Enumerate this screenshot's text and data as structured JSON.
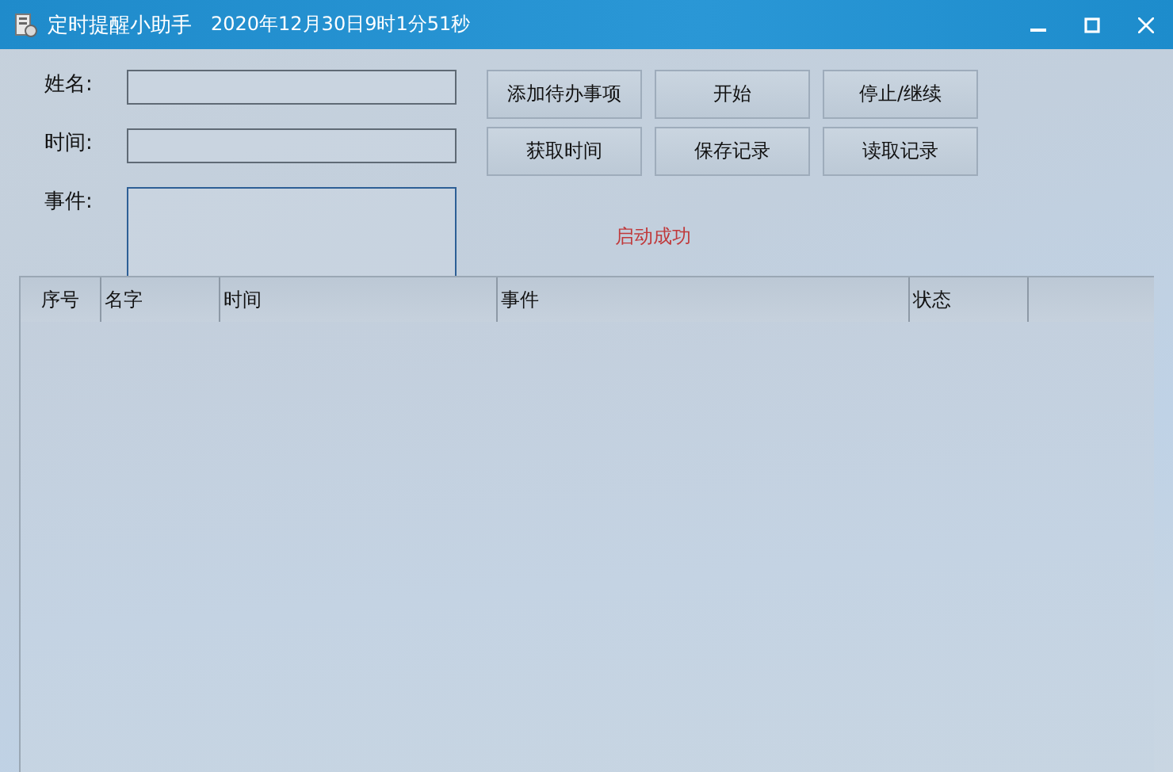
{
  "window": {
    "title": "定时提醒小助手",
    "datetime": "2020年12月30日9时1分51秒"
  },
  "form": [
    {
      "label": "姓名:",
      "kind": "line"
    },
    {
      "label": "时间:",
      "kind": "line"
    },
    {
      "label": "事件:",
      "kind": "area"
    }
  ],
  "buttons": [
    "添加待办事项",
    "开始",
    "停止/继续",
    "获取时间",
    "保存记录",
    "读取记录"
  ],
  "status_message": "启动成功",
  "table": {
    "columns": [
      "序号",
      "名字",
      "时间",
      "事件",
      "状态"
    ]
  }
}
